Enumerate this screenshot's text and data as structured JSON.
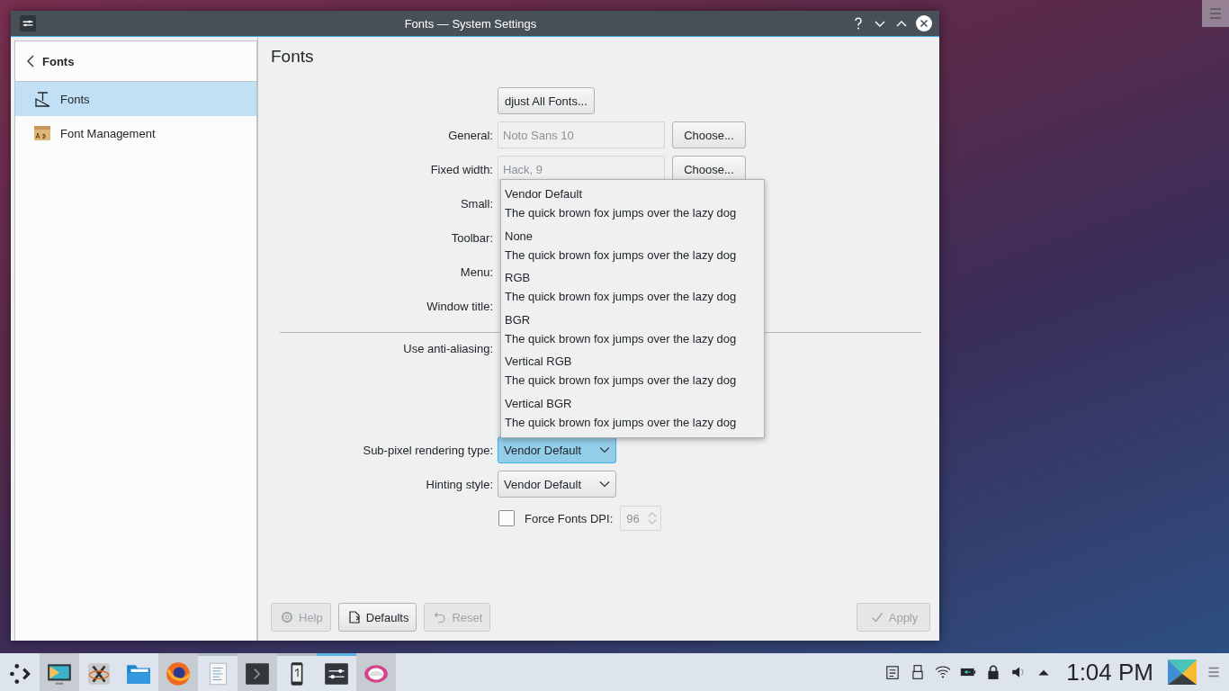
{
  "window": {
    "title": "Fonts — System Settings"
  },
  "sidebar": {
    "back_label": "Fonts",
    "items": [
      {
        "label": "Fonts",
        "selected": true
      },
      {
        "label": "Font Management",
        "selected": false
      }
    ]
  },
  "page_title": "Fonts",
  "adjust_button": "djust All Fonts...",
  "font_rows": [
    {
      "label": "General:",
      "value": "Noto Sans 10",
      "button": "Choose..."
    },
    {
      "label": "Fixed width:",
      "value": "Hack, 9",
      "button": "Choose..."
    },
    {
      "label": "Small:"
    },
    {
      "label": "Toolbar:"
    },
    {
      "label": "Menu:"
    },
    {
      "label": "Window title:"
    }
  ],
  "antialias_label": "Use anti-aliasing:",
  "selects": [
    {
      "label": "Sub-pixel rendering type:",
      "value": "Vendor Default",
      "open": true
    },
    {
      "label": "Hinting style:",
      "value": "Vendor Default",
      "open": false
    }
  ],
  "force_dpi": {
    "label": "Force Fonts DPI:",
    "checked": false,
    "value": "96"
  },
  "dropdown": [
    {
      "name": "Vendor Default",
      "sample": "The quick brown fox jumps over the lazy dog"
    },
    {
      "name": "None",
      "sample": "The quick brown fox jumps over the lazy dog"
    },
    {
      "name": "RGB",
      "sample": "The quick brown fox jumps over the lazy dog"
    },
    {
      "name": "BGR",
      "sample": "The quick brown fox jumps over the lazy dog"
    },
    {
      "name": "Vertical RGB",
      "sample": "The quick brown fox jumps over the lazy dog"
    },
    {
      "name": "Vertical BGR",
      "sample": "The quick brown fox jumps over the lazy dog"
    }
  ],
  "footer_left": [
    {
      "label": "Help",
      "disabled": true
    },
    {
      "label": "Defaults",
      "disabled": false
    },
    {
      "label": "Reset",
      "disabled": true
    }
  ],
  "footer_right": [
    {
      "label": "Apply",
      "disabled": true
    }
  ],
  "taskbar": {
    "items": [
      {
        "highlighted": false,
        "running": false,
        "selected": false
      },
      {
        "highlighted": true,
        "running": false,
        "selected": false
      },
      {
        "highlighted": false,
        "running": false,
        "selected": false
      },
      {
        "highlighted": false,
        "running": false,
        "selected": false
      },
      {
        "highlighted": true,
        "running": false,
        "selected": false
      },
      {
        "highlighted": false,
        "running": true,
        "selected": false
      },
      {
        "highlighted": true,
        "running": false,
        "selected": false
      },
      {
        "highlighted": false,
        "running": true,
        "selected": false
      },
      {
        "highlighted": false,
        "running": true,
        "selected": true
      },
      {
        "highlighted": true,
        "running": false,
        "selected": false
      }
    ],
    "clock": "1:04 PM"
  }
}
